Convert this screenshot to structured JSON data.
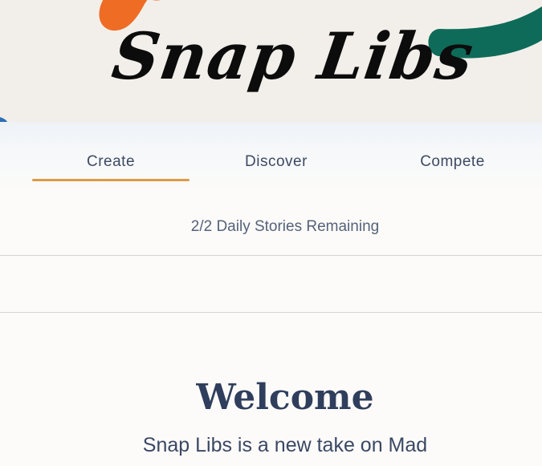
{
  "header": {
    "logo_text": "Snap Libs"
  },
  "tabs": [
    {
      "label": "Create",
      "active": true
    },
    {
      "label": "Discover",
      "active": false
    },
    {
      "label": "Compete",
      "active": false
    }
  ],
  "status": {
    "stories_remaining": "2/2 Daily Stories Remaining"
  },
  "main": {
    "heading": "Welcome",
    "intro_text": "Snap Libs is a new take on Mad"
  },
  "colors": {
    "accent": "#df9a45",
    "banner_bg": "#f2efea",
    "text_primary": "#2f3e5c",
    "deco_orange": "#ef6c25",
    "deco_green": "#0e6b59",
    "deco_blue": "#2f6fb3"
  }
}
